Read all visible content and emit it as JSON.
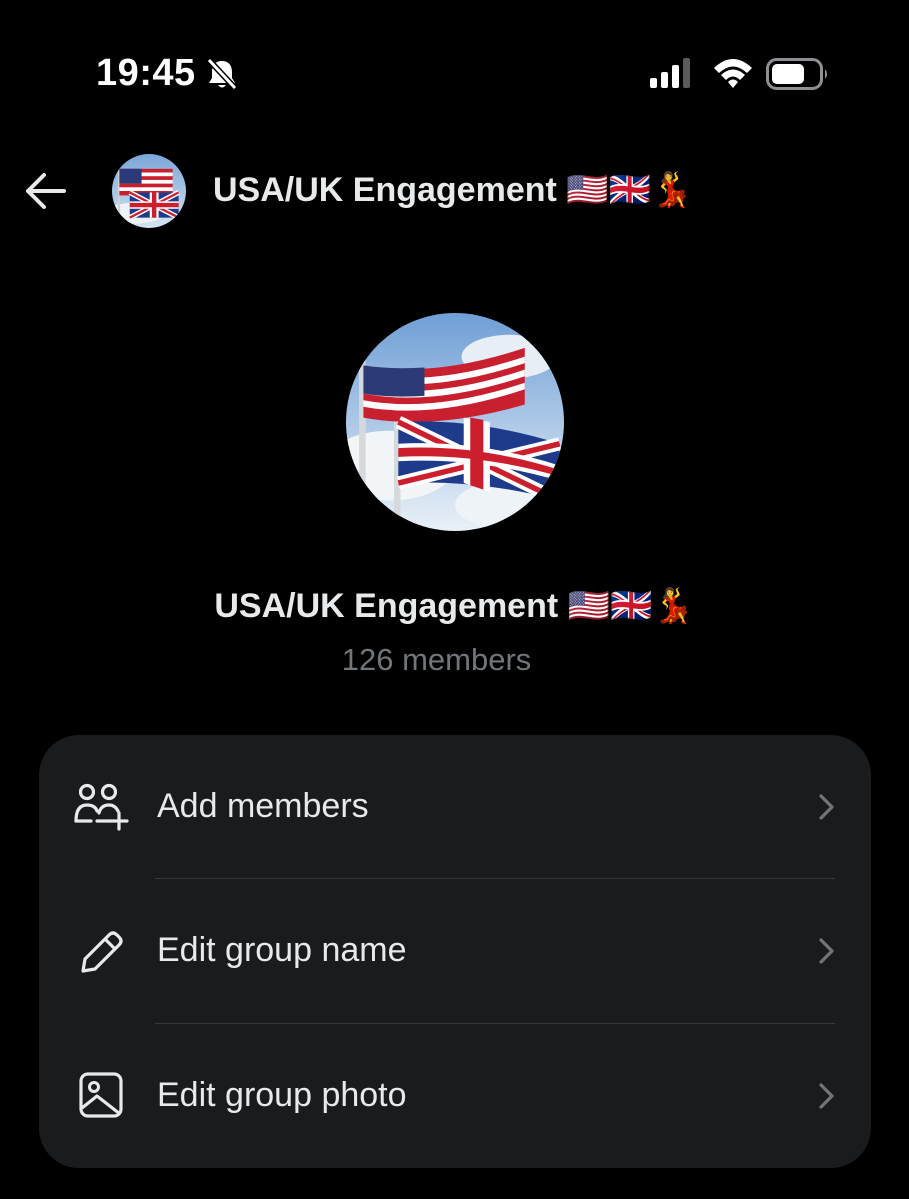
{
  "status_bar": {
    "time": "19:45",
    "icons": [
      "bell-muted-icon",
      "cellular-signal-icon",
      "wifi-icon",
      "battery-icon"
    ]
  },
  "header": {
    "title": "USA/UK Engagement 🇺🇸🇬🇧💃",
    "back_icon": "back-arrow-icon"
  },
  "group": {
    "name": "USA/UK Engagement 🇺🇸🇬🇧💃",
    "member_count": "126 members"
  },
  "actions": [
    {
      "label": "Add members",
      "icon": "add-members-icon"
    },
    {
      "label": "Edit group name",
      "icon": "pencil-icon"
    },
    {
      "label": "Edit group photo",
      "icon": "image-icon"
    }
  ],
  "colors": {
    "background": "#000000",
    "card": "#1a1b1d",
    "text_primary": "#e7e9ea",
    "text_secondary": "#71767b",
    "divider": "#34373b"
  }
}
